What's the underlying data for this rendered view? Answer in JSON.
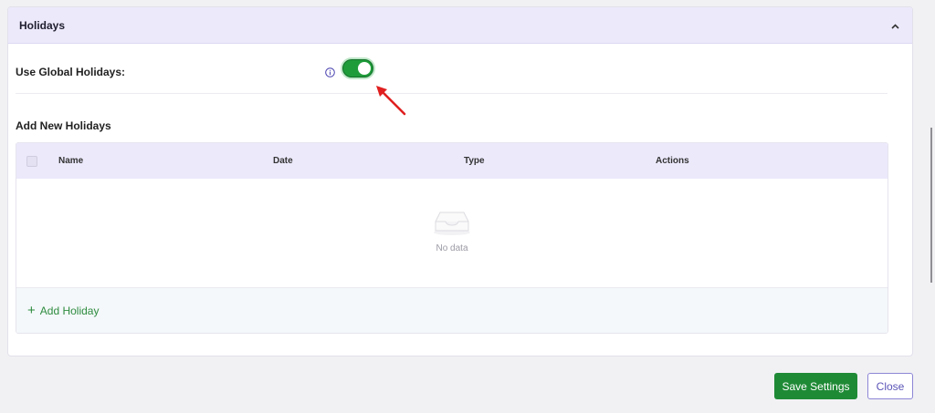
{
  "panel": {
    "title": "Holidays",
    "collapse_icon": "chevron-up-icon"
  },
  "global_holidays": {
    "label": "Use Global Holidays:",
    "info_icon": "info-icon",
    "enabled": true,
    "toggle_color": "#1f9c3a"
  },
  "annotation": {
    "arrow_color": "#e02020"
  },
  "add_section": {
    "title": "Add New Holidays"
  },
  "table": {
    "columns": [
      "Name",
      "Date",
      "Type",
      "Actions"
    ],
    "rows": [],
    "empty_text": "No data",
    "add_label": "Add Holiday"
  },
  "footer": {
    "save_label": "Save Settings",
    "close_label": "Close",
    "save_color": "#1f8a36"
  }
}
